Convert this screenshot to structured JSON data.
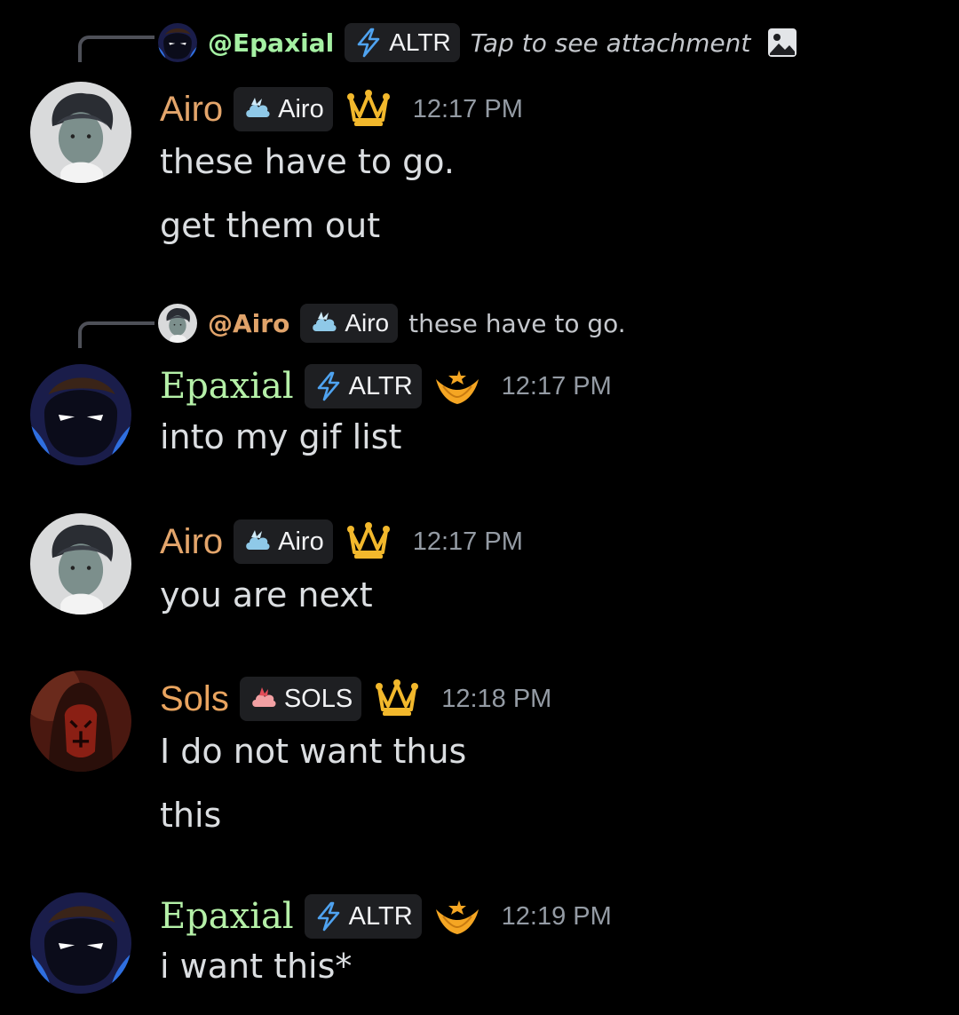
{
  "messages": [
    {
      "reply": {
        "name": "@Epaxial",
        "tag": "ALTR",
        "text": "Tap to see attachment"
      },
      "author": "Airo",
      "tag": "Airo",
      "time": "12:17 PM",
      "lines": [
        "these have to go.",
        "get them out"
      ]
    },
    {
      "reply": {
        "name": "@Airo",
        "tag": "Airo",
        "text": "these have to go."
      },
      "author": "Epaxial",
      "tag": "ALTR",
      "time": "12:17 PM",
      "lines": [
        "into my gif list"
      ]
    },
    {
      "author": "Airo",
      "tag": "Airo",
      "time": "12:17 PM",
      "lines": [
        "you are next"
      ]
    },
    {
      "author": "Sols",
      "tag": "SOLS",
      "time": "12:18 PM",
      "lines": [
        "I do not want thus",
        "this"
      ]
    },
    {
      "author": "Epaxial",
      "tag": "ALTR",
      "time": "12:19 PM",
      "lines": [
        "i want this*"
      ]
    }
  ],
  "icons": {
    "airo_tag": "cloud-icon",
    "altr_tag": "lightning-icon",
    "sols_tag": "flame-icon",
    "crown_badge": "crown-icon",
    "epaxial_badge": "star-crest-icon",
    "attachment": "image-icon"
  },
  "colors": {
    "background": "#000000",
    "airo_name": "#e3a56b",
    "epaxial_name": "#b5f0a8",
    "sols_name": "#e9a45f",
    "timestamp": "#949ba4",
    "tag_bg": "#1e1f22",
    "crown": "#f0b429"
  }
}
